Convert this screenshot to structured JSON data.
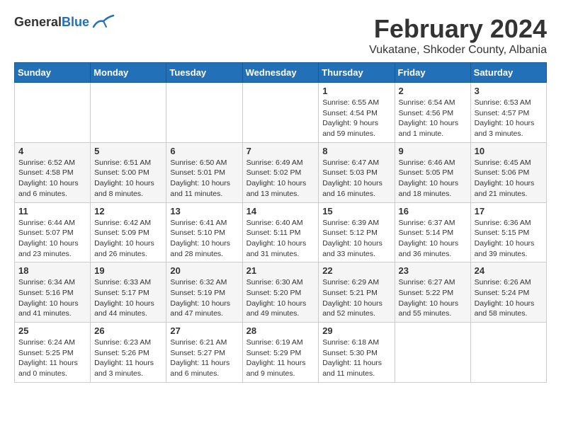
{
  "header": {
    "logo_general": "General",
    "logo_blue": "Blue",
    "main_title": "February 2024",
    "subtitle": "Vukatane, Shkoder County, Albania"
  },
  "calendar": {
    "days_of_week": [
      "Sunday",
      "Monday",
      "Tuesday",
      "Wednesday",
      "Thursday",
      "Friday",
      "Saturday"
    ],
    "weeks": [
      [
        {
          "day": "",
          "info": ""
        },
        {
          "day": "",
          "info": ""
        },
        {
          "day": "",
          "info": ""
        },
        {
          "day": "",
          "info": ""
        },
        {
          "day": "1",
          "info": "Sunrise: 6:55 AM\nSunset: 4:54 PM\nDaylight: 9 hours\nand 59 minutes."
        },
        {
          "day": "2",
          "info": "Sunrise: 6:54 AM\nSunset: 4:56 PM\nDaylight: 10 hours\nand 1 minute."
        },
        {
          "day": "3",
          "info": "Sunrise: 6:53 AM\nSunset: 4:57 PM\nDaylight: 10 hours\nand 3 minutes."
        }
      ],
      [
        {
          "day": "4",
          "info": "Sunrise: 6:52 AM\nSunset: 4:58 PM\nDaylight: 10 hours\nand 6 minutes."
        },
        {
          "day": "5",
          "info": "Sunrise: 6:51 AM\nSunset: 5:00 PM\nDaylight: 10 hours\nand 8 minutes."
        },
        {
          "day": "6",
          "info": "Sunrise: 6:50 AM\nSunset: 5:01 PM\nDaylight: 10 hours\nand 11 minutes."
        },
        {
          "day": "7",
          "info": "Sunrise: 6:49 AM\nSunset: 5:02 PM\nDaylight: 10 hours\nand 13 minutes."
        },
        {
          "day": "8",
          "info": "Sunrise: 6:47 AM\nSunset: 5:03 PM\nDaylight: 10 hours\nand 16 minutes."
        },
        {
          "day": "9",
          "info": "Sunrise: 6:46 AM\nSunset: 5:05 PM\nDaylight: 10 hours\nand 18 minutes."
        },
        {
          "day": "10",
          "info": "Sunrise: 6:45 AM\nSunset: 5:06 PM\nDaylight: 10 hours\nand 21 minutes."
        }
      ],
      [
        {
          "day": "11",
          "info": "Sunrise: 6:44 AM\nSunset: 5:07 PM\nDaylight: 10 hours\nand 23 minutes."
        },
        {
          "day": "12",
          "info": "Sunrise: 6:42 AM\nSunset: 5:09 PM\nDaylight: 10 hours\nand 26 minutes."
        },
        {
          "day": "13",
          "info": "Sunrise: 6:41 AM\nSunset: 5:10 PM\nDaylight: 10 hours\nand 28 minutes."
        },
        {
          "day": "14",
          "info": "Sunrise: 6:40 AM\nSunset: 5:11 PM\nDaylight: 10 hours\nand 31 minutes."
        },
        {
          "day": "15",
          "info": "Sunrise: 6:39 AM\nSunset: 5:12 PM\nDaylight: 10 hours\nand 33 minutes."
        },
        {
          "day": "16",
          "info": "Sunrise: 6:37 AM\nSunset: 5:14 PM\nDaylight: 10 hours\nand 36 minutes."
        },
        {
          "day": "17",
          "info": "Sunrise: 6:36 AM\nSunset: 5:15 PM\nDaylight: 10 hours\nand 39 minutes."
        }
      ],
      [
        {
          "day": "18",
          "info": "Sunrise: 6:34 AM\nSunset: 5:16 PM\nDaylight: 10 hours\nand 41 minutes."
        },
        {
          "day": "19",
          "info": "Sunrise: 6:33 AM\nSunset: 5:17 PM\nDaylight: 10 hours\nand 44 minutes."
        },
        {
          "day": "20",
          "info": "Sunrise: 6:32 AM\nSunset: 5:19 PM\nDaylight: 10 hours\nand 47 minutes."
        },
        {
          "day": "21",
          "info": "Sunrise: 6:30 AM\nSunset: 5:20 PM\nDaylight: 10 hours\nand 49 minutes."
        },
        {
          "day": "22",
          "info": "Sunrise: 6:29 AM\nSunset: 5:21 PM\nDaylight: 10 hours\nand 52 minutes."
        },
        {
          "day": "23",
          "info": "Sunrise: 6:27 AM\nSunset: 5:22 PM\nDaylight: 10 hours\nand 55 minutes."
        },
        {
          "day": "24",
          "info": "Sunrise: 6:26 AM\nSunset: 5:24 PM\nDaylight: 10 hours\nand 58 minutes."
        }
      ],
      [
        {
          "day": "25",
          "info": "Sunrise: 6:24 AM\nSunset: 5:25 PM\nDaylight: 11 hours\nand 0 minutes."
        },
        {
          "day": "26",
          "info": "Sunrise: 6:23 AM\nSunset: 5:26 PM\nDaylight: 11 hours\nand 3 minutes."
        },
        {
          "day": "27",
          "info": "Sunrise: 6:21 AM\nSunset: 5:27 PM\nDaylight: 11 hours\nand 6 minutes."
        },
        {
          "day": "28",
          "info": "Sunrise: 6:19 AM\nSunset: 5:29 PM\nDaylight: 11 hours\nand 9 minutes."
        },
        {
          "day": "29",
          "info": "Sunrise: 6:18 AM\nSunset: 5:30 PM\nDaylight: 11 hours\nand 11 minutes."
        },
        {
          "day": "",
          "info": ""
        },
        {
          "day": "",
          "info": ""
        }
      ]
    ]
  }
}
